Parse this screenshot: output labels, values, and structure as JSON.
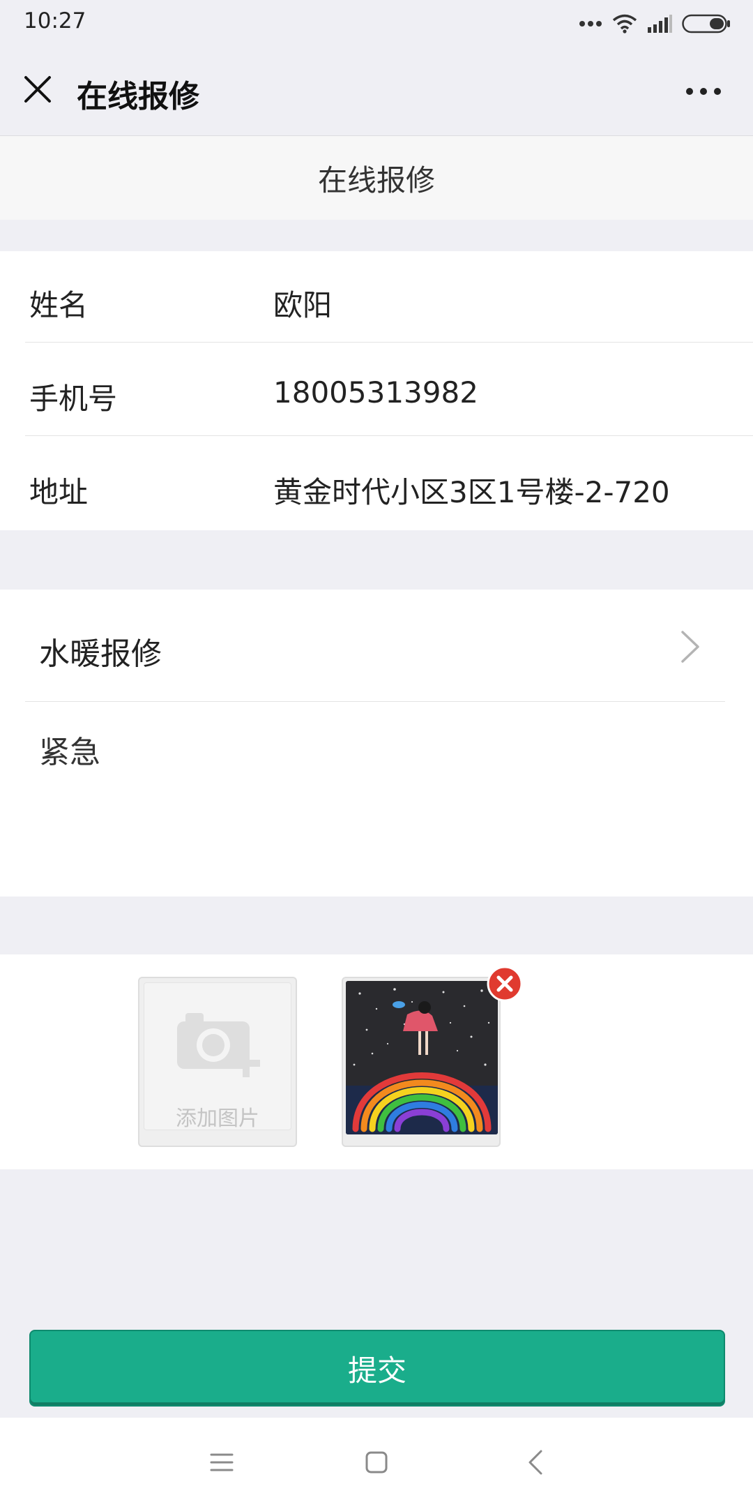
{
  "status_bar": {
    "time": "10:27"
  },
  "top_bar": {
    "title": "在线报修"
  },
  "page_header": {
    "title": "在线报修"
  },
  "form": {
    "rows": [
      {
        "label": "姓名",
        "value": "欧阳"
      },
      {
        "label": "手机号",
        "value": "18005313982"
      },
      {
        "label": "地址",
        "value": "黄金时代小区3区1号楼-2-720"
      }
    ]
  },
  "repair": {
    "type_value": "水暖报修",
    "description": "紧急"
  },
  "photos": {
    "add_label": "添加图片"
  },
  "submit": {
    "label": "提交"
  },
  "colors": {
    "accent": "#1aad8b",
    "page_background": "#efeff4",
    "remove_badge": "#e03a2f"
  },
  "icons": {
    "close": "close-icon",
    "more": "more-icon",
    "chevron": "chevron-right-icon",
    "camera": "camera-add-icon",
    "remove": "remove-photo-icon",
    "nav_menu": "menu-icon",
    "nav_home": "home-icon",
    "nav_back": "back-icon"
  }
}
